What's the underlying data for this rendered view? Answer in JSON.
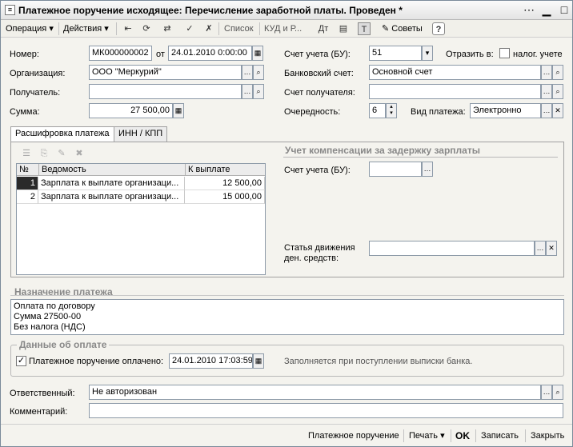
{
  "window": {
    "title": "Платежное поручение исходящее: Перечисление заработной платы. Проведен *"
  },
  "toolbar": {
    "operation": "Операция",
    "actions": "Действия",
    "list": "Список",
    "kudir": "КУД и Р...",
    "tips": "Советы",
    "help": "?"
  },
  "form": {
    "number_label": "Номер:",
    "number_value": "МК000000002",
    "from_label": "от",
    "date_value": "24.01.2010  0:00:00",
    "org_label": "Организация:",
    "org_value": "ООО \"Меркурий\"",
    "recipient_label": "Получатель:",
    "recipient_value": "",
    "sum_label": "Сумма:",
    "sum_value": "27 500,00",
    "account_bu_label": "Счет учета (БУ):",
    "account_bu_value": "51",
    "reflect_label": "Отразить в:",
    "tax_label": "налог. учете",
    "bank_account_label": "Банковский счет:",
    "bank_account_value": "Основной счет",
    "recipient_account_label": "Счет получателя:",
    "recipient_account_value": "",
    "priority_label": "Очередность:",
    "priority_value": "6",
    "payment_type_label": "Вид платежа:",
    "payment_type_value": "Электронно"
  },
  "tabs": [
    "Расшифровка платежа",
    "ИНН / КПП"
  ],
  "table": {
    "headers": [
      "№",
      "Ведомость",
      "К выплате"
    ],
    "rows": [
      {
        "n": "1",
        "doc": "Зарплата к выплате организаци...",
        "amount": "12 500,00"
      },
      {
        "n": "2",
        "doc": "Зарплата к выплате организаци...",
        "amount": "15 000,00"
      }
    ]
  },
  "compensation": {
    "title": "Учет компенсации за задержку зарплаты",
    "account_label": "Счет учета (БУ):",
    "article_label_1": "Статья движения",
    "article_label_2": "ден. средств:"
  },
  "purpose": {
    "title": "Назначение платежа",
    "line1": "Оплата по договору",
    "line2": "Сумма 27500-00",
    "line3": "Без налога (НДС)"
  },
  "payment": {
    "title": "Данные об оплате",
    "paid_label": "Платежное поручение оплачено:",
    "paid_date": "24.01.2010 17:03:59",
    "hint": "Заполняется при поступлении выписки банка."
  },
  "responsible": {
    "label": "Ответственный:",
    "value": "Не авторизован"
  },
  "comment": {
    "label": "Комментарий:",
    "value": ""
  },
  "bottom": {
    "print_form": "Платежное поручение",
    "print": "Печать",
    "ok": "OK",
    "save": "Записать",
    "close": "Закрыть"
  }
}
